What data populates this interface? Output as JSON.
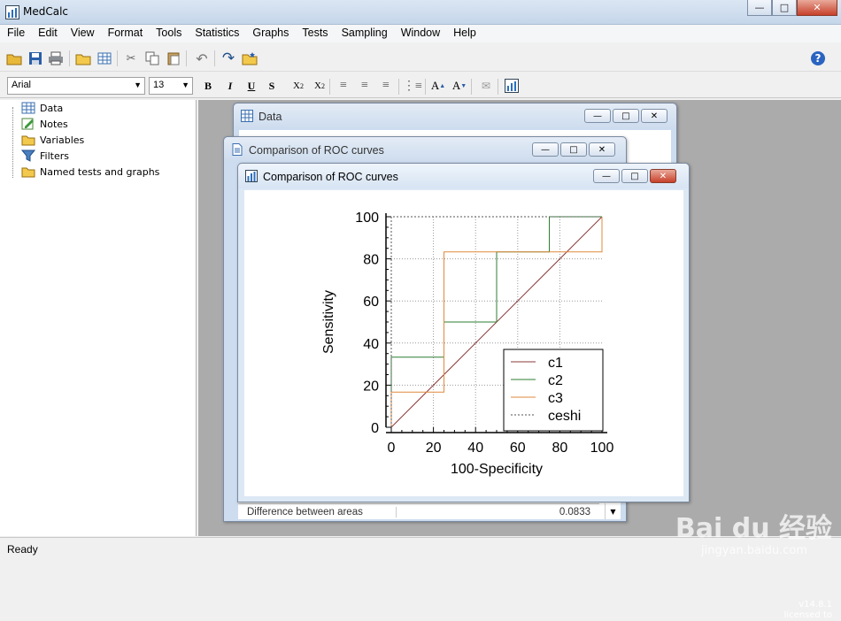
{
  "app": {
    "title": "MedCalc",
    "version": "v14.8.1",
    "licensed": "licensed to"
  },
  "menu": [
    "File",
    "Edit",
    "View",
    "Format",
    "Tools",
    "Statistics",
    "Graphs",
    "Tests",
    "Sampling",
    "Window",
    "Help"
  ],
  "toolbar2": {
    "font_name": "Arial",
    "font_size": "13"
  },
  "tree": [
    "Data",
    "Notes",
    "Variables",
    "Filters",
    "Named tests and graphs"
  ],
  "windows": {
    "data": {
      "title": "Data"
    },
    "roc_results": {
      "title": "Comparison of ROC curves",
      "row_label": "Difference between areas",
      "row_value": "0.0833"
    },
    "roc_graph": {
      "title": "Comparison of ROC curves"
    }
  },
  "chart_data": {
    "type": "line",
    "title": "",
    "xlabel": "100-Specificity",
    "ylabel": "Sensitivity",
    "xlim": [
      0,
      100
    ],
    "ylim": [
      0,
      100
    ],
    "xticks": [
      0,
      20,
      40,
      60,
      80,
      100
    ],
    "yticks": [
      0,
      20,
      40,
      60,
      80,
      100
    ],
    "grid": true,
    "legend_position": "bottom-right",
    "series": [
      {
        "name": "c1",
        "color": "#8b3a3a",
        "style": "solid",
        "points": [
          [
            0,
            0
          ],
          [
            100,
            100
          ]
        ]
      },
      {
        "name": "c2",
        "color": "#2e7d32",
        "style": "solid",
        "points": [
          [
            0,
            0
          ],
          [
            0,
            33.3
          ],
          [
            25,
            33.3
          ],
          [
            25,
            50
          ],
          [
            50,
            50
          ],
          [
            50,
            83.3
          ],
          [
            75,
            83.3
          ],
          [
            75,
            100
          ],
          [
            100,
            100
          ]
        ]
      },
      {
        "name": "c3",
        "color": "#e08a3c",
        "style": "solid",
        "points": [
          [
            0,
            0
          ],
          [
            0,
            16.7
          ],
          [
            25,
            16.7
          ],
          [
            25,
            83.3
          ],
          [
            100,
            83.3
          ],
          [
            100,
            100
          ]
        ]
      },
      {
        "name": "ceshi",
        "color": "#555555",
        "style": "dotted",
        "points": [
          [
            0,
            0
          ],
          [
            0,
            100
          ],
          [
            100,
            100
          ]
        ]
      }
    ]
  },
  "status": {
    "text": "Ready"
  },
  "watermark": {
    "brand": "Bai du 经验",
    "url": "jingyan.baidu.com"
  }
}
